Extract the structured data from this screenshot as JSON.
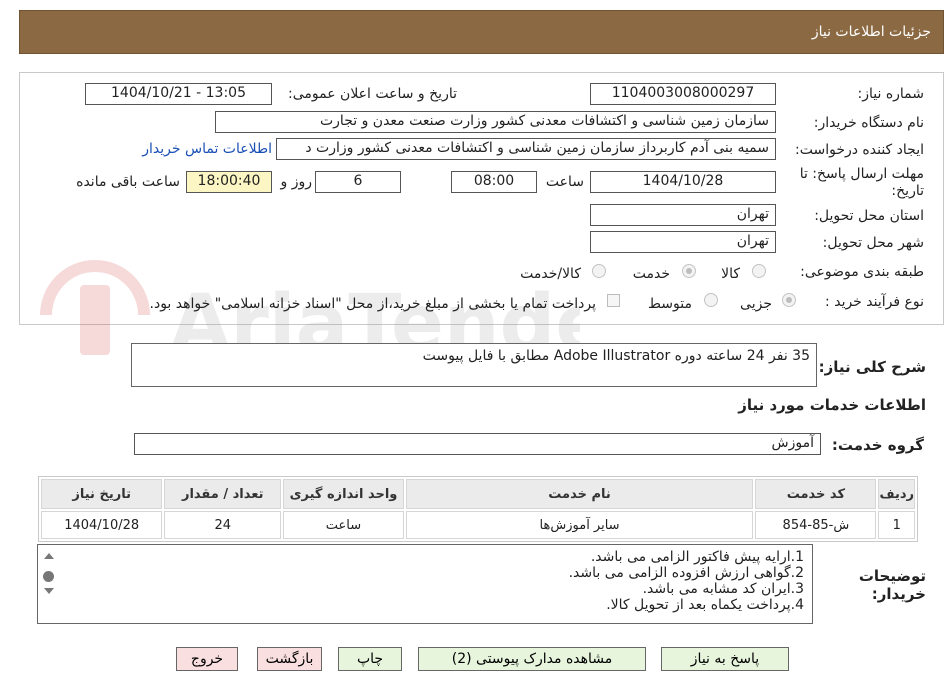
{
  "header": {
    "title": "جزئیات اطلاعات نیاز"
  },
  "form": {
    "need_number_label": "شماره نیاز:",
    "need_number_value": "1104003008000297",
    "announce_label": "تاریخ و ساعت اعلان عمومی:",
    "announce_value": "1404/10/21 - 13:05",
    "buyer_org_label": "نام دستگاه خریدار:",
    "buyer_org_value": "سازمان زمین شناسی و اکتشافات معدنی کشور وزارت صنعت معدن و تجارت",
    "requester_label": "ایجاد کننده درخواست:",
    "requester_value": "سمیه بنی آدم کاربرداز سازمان زمین شناسی و اکتشافات معدنی کشور وزارت د",
    "contact_link": "اطلاعات تماس خریدار",
    "deadline_label": "مهلت ارسال پاسخ: تا تاریخ:",
    "deadline_date": "1404/10/28",
    "time_label": "ساعت",
    "deadline_time": "08:00",
    "days_value": "6",
    "days_label": "روز و",
    "remaining_value": "18:00:40",
    "remaining_label": "ساعت باقی مانده",
    "province_label": "استان محل تحویل:",
    "province_value": "تهران",
    "city_label": "شهر محل تحویل:",
    "city_value": "تهران",
    "category_label": "طبقه بندی موضوعی:",
    "category_options": [
      "کالا",
      "خدمت",
      "کالا/خدمت"
    ],
    "category_selected": "خدمت",
    "process_label": "نوع فرآیند خرید :",
    "process_options": [
      "جزیی",
      "متوسط"
    ],
    "process_selected": "جزیی",
    "payment_note": "پرداخت تمام یا بخشی از مبلغ خرید،از محل \"اسناد خزانه اسلامی\" خواهد بود."
  },
  "description": {
    "label": "شرح کلی نیاز:",
    "value": "35 نفر 24 ساعته دوره Adobe Illustrator  مطابق با فایل پیوست"
  },
  "services": {
    "section_title": "اطلاعات خدمات مورد نیاز",
    "group_label": "گروه خدمت:",
    "group_value": "آموزش",
    "columns": [
      "ردیف",
      "کد خدمت",
      "نام خدمت",
      "واحد اندازه گیری",
      "تعداد / مقدار",
      "تاریخ نیاز"
    ],
    "rows": [
      [
        "1",
        "ش-85-854",
        "سایر آموزش‌ها",
        "ساعت",
        "24",
        "1404/10/28"
      ]
    ]
  },
  "notes": {
    "label": "توضیحات خریدار:",
    "lines": [
      "1.ارایه پیش فاکتور الزامی می باشد.",
      "2.گواهی ارزش افزوده الزامی می باشد.",
      "3.ایران کد مشابه می باشد.",
      "4.پرداخت یکماه بعد از تحویل کالا."
    ]
  },
  "buttons": {
    "respond": "پاسخ به نیاز",
    "attachments": "مشاهده مدارک پیوستی (2)",
    "print": "چاپ",
    "back": "بازگشت",
    "exit": "خروج"
  },
  "watermark": {
    "text": "AriaTender.neT"
  },
  "colors": {
    "header_bg": "#8b6a43",
    "remaining_bg": "#fbf6c4",
    "btn_green": "#e7f5dd",
    "btn_pink": "#f9dfdf",
    "link": "#1a4fb5"
  }
}
